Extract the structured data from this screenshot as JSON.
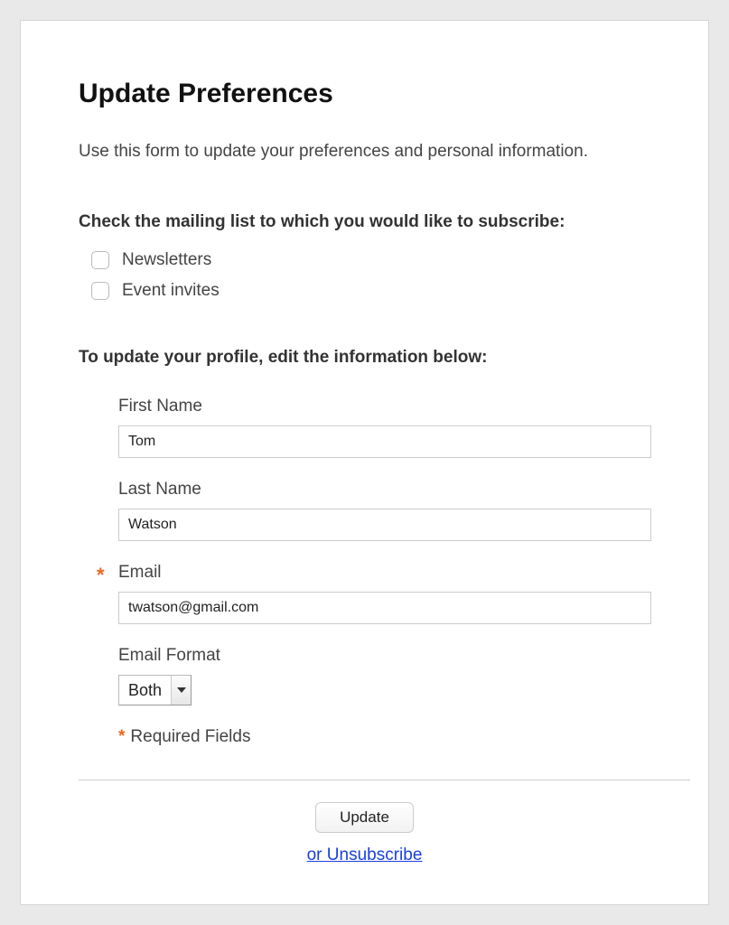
{
  "header": {
    "title": "Update Preferences",
    "intro": "Use this form to update your preferences and personal information."
  },
  "mailing": {
    "heading": "Check the mailing list to which you would like to subscribe:",
    "items": [
      {
        "label": "Newsletters",
        "checked": false
      },
      {
        "label": "Event invites",
        "checked": false
      }
    ]
  },
  "profile": {
    "heading": "To update your profile, edit the information below:",
    "first_name": {
      "label": "First Name",
      "value": "Tom"
    },
    "last_name": {
      "label": "Last Name",
      "value": "Watson"
    },
    "email": {
      "label": "Email",
      "value": "twatson@gmail.com",
      "required": true
    },
    "email_format": {
      "label": "Email Format",
      "value": "Both"
    },
    "required_legend": "Required Fields"
  },
  "footer": {
    "update_label": "Update",
    "unsubscribe_label": "or Unsubscribe"
  }
}
